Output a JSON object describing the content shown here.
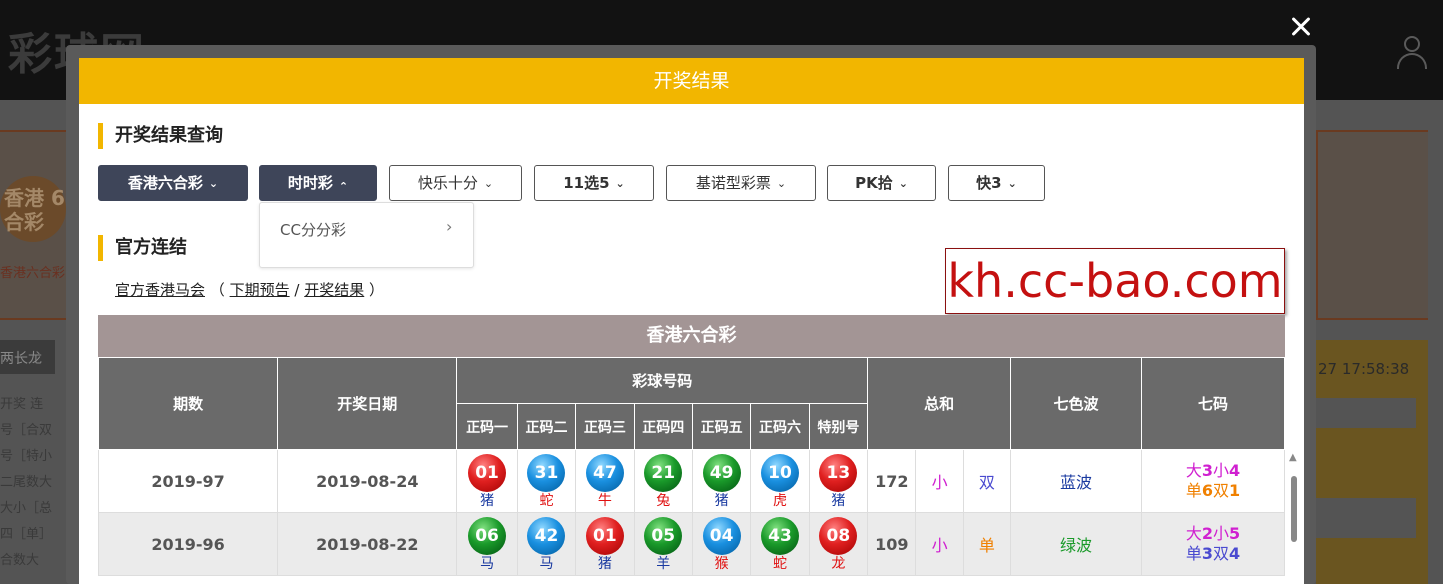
{
  "background": {
    "logo": "彩球网",
    "left_label": "香港六合彩",
    "left_badge": "香港 6合彩",
    "left_tab": "两长龙",
    "left_list": [
      "开奖  连",
      "号［合双",
      "号［特小",
      "二尾数大",
      "大小［总",
      "四［单］",
      "合数大"
    ],
    "time": "27 17:58:38"
  },
  "modal": {
    "title": "开奖结果",
    "query_title": "开奖结果查询",
    "buttons": [
      "香港六合彩",
      "时时彩",
      "快乐十分",
      "11选5",
      "基诺型彩票",
      "PK拾",
      "快3"
    ],
    "dropdown_item": "CC分分彩",
    "links_title": "官方连结",
    "links": {
      "official": "官方香港马会",
      "open_paren": "（",
      "next": "下期预告",
      "slash": "/",
      "result": "开奖结果",
      "close_paren": "）"
    },
    "watermark": "kh.cc-bao.com"
  },
  "table": {
    "title": "香港六合彩",
    "headers": {
      "period": "期数",
      "date": "开奖日期",
      "balls": "彩球号码",
      "ball_cols": [
        "正码一",
        "正码二",
        "正码三",
        "正码四",
        "正码五",
        "正码六",
        "特别号"
      ],
      "sum": "总和",
      "wave": "七色波",
      "seven": "七码"
    },
    "rows": [
      {
        "period": "2019-97",
        "date": "2019-08-24",
        "balls": [
          {
            "num": "01",
            "color": "red",
            "zodiac": "猪",
            "zc": "zblue"
          },
          {
            "num": "31",
            "color": "blue",
            "zodiac": "蛇",
            "zc": "zred"
          },
          {
            "num": "47",
            "color": "blue",
            "zodiac": "牛",
            "zc": "zred"
          },
          {
            "num": "21",
            "color": "green",
            "zodiac": "兔",
            "zc": "zred"
          },
          {
            "num": "49",
            "color": "green",
            "zodiac": "猪",
            "zc": "zblue"
          },
          {
            "num": "10",
            "color": "blue",
            "zodiac": "虎",
            "zc": "zred"
          },
          {
            "num": "13",
            "color": "red",
            "zodiac": "猪",
            "zc": "zblue"
          }
        ],
        "sum": "172",
        "size": "小",
        "parity": "双",
        "parity_color": "#4a4ad0",
        "wave": "蓝波",
        "wave_color": "#1a3aa0",
        "seven_1": {
          "pre": "大",
          "a": "3",
          "mid": "小",
          "b": "4",
          "color": "#d020d0"
        },
        "seven_2": {
          "pre": "单",
          "a": "6",
          "mid": "双",
          "b": "1",
          "color": "#f08000"
        }
      },
      {
        "period": "2019-96",
        "date": "2019-08-22",
        "balls": [
          {
            "num": "06",
            "color": "green",
            "zodiac": "马",
            "zc": "zblue"
          },
          {
            "num": "42",
            "color": "blue",
            "zodiac": "马",
            "zc": "zblue"
          },
          {
            "num": "01",
            "color": "red",
            "zodiac": "猪",
            "zc": "zblue"
          },
          {
            "num": "05",
            "color": "green",
            "zodiac": "羊",
            "zc": "zblue"
          },
          {
            "num": "04",
            "color": "blue",
            "zodiac": "猴",
            "zc": "zred"
          },
          {
            "num": "43",
            "color": "green",
            "zodiac": "蛇",
            "zc": "zred"
          },
          {
            "num": "08",
            "color": "red",
            "zodiac": "龙",
            "zc": "zred"
          }
        ],
        "sum": "109",
        "size": "小",
        "parity": "单",
        "parity_color": "#f08000",
        "wave": "绿波",
        "wave_color": "#1a9a2a",
        "seven_1": {
          "pre": "大",
          "a": "2",
          "mid": "小",
          "b": "5",
          "color": "#d020d0"
        },
        "seven_2": {
          "pre": "单",
          "a": "3",
          "mid": "双",
          "b": "4",
          "color": "#4a4ad0"
        }
      }
    ]
  }
}
